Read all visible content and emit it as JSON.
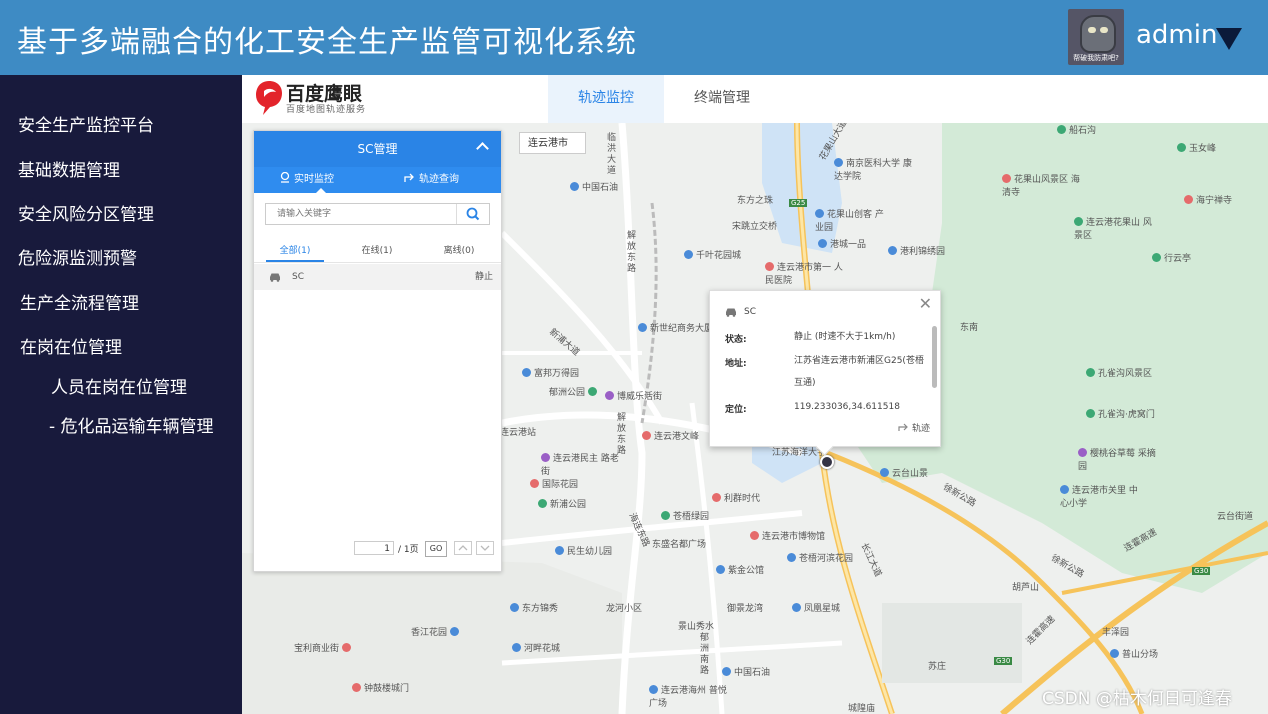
{
  "header": {
    "title": "基于多端融合的化工安全生产监管可视化系统",
    "avatar_caption": "帮破我防肃吧?",
    "username": "admin"
  },
  "sidebar": {
    "items": [
      {
        "label": "安全生产监控平台"
      },
      {
        "label": "基础数据管理"
      },
      {
        "label": "安全风险分区管理"
      },
      {
        "label": "危险源监测预警"
      },
      {
        "label": "生产全流程管理"
      },
      {
        "label": "在岗在位管理"
      },
      {
        "label": "人员在岗在位管理"
      },
      {
        "label": "- 危化品运输车辆管理"
      }
    ]
  },
  "topbar": {
    "logo_title": "百度鹰眼",
    "logo_subtitle": "百度地图轨迹服务",
    "tabs": [
      {
        "label": "轨迹监控"
      },
      {
        "label": "终端管理"
      }
    ]
  },
  "map": {
    "city_selector": "连云港市",
    "pois": [
      {
        "label": "船石沟"
      },
      {
        "label": "玉女峰"
      },
      {
        "label": "花果山风景区 海清寺"
      },
      {
        "label": "海宁禅寺"
      },
      {
        "label": "连云港花果山 风景区"
      },
      {
        "label": "行云亭"
      },
      {
        "label": "南京医科大学 康达学院"
      },
      {
        "label": "花果山创客 产业园"
      },
      {
        "label": "东方之珠"
      },
      {
        "label": "宋跳立交桥"
      },
      {
        "label": "港城一品"
      },
      {
        "label": "港利锦绣园"
      },
      {
        "label": "中国石油"
      },
      {
        "label": "千叶花园城"
      },
      {
        "label": "连云港市第一 人民医院"
      },
      {
        "label": "新世纪商务大厦"
      },
      {
        "label": "富邦万得园"
      },
      {
        "label": "郁洲公园"
      },
      {
        "label": "博威乐活街"
      },
      {
        "label": "连云港文峰"
      },
      {
        "label": "连云港站"
      },
      {
        "label": "连云港民主 路老街"
      },
      {
        "label": "国际花园"
      },
      {
        "label": "新浦公园"
      },
      {
        "label": "利群时代"
      },
      {
        "label": "苍梧绿园"
      },
      {
        "label": "连云港市博物馆"
      },
      {
        "label": "东盛名都广场"
      },
      {
        "label": "苍梧河滨花园"
      },
      {
        "label": "民生幼儿园"
      },
      {
        "label": "紫金公馆"
      },
      {
        "label": "御景龙湾"
      },
      {
        "label": "东方锦秀"
      },
      {
        "label": "龙河小区"
      },
      {
        "label": "凤凰星城"
      },
      {
        "label": "景山秀水"
      },
      {
        "label": "香江花园"
      },
      {
        "label": "河畔花城"
      },
      {
        "label": "宝利商业街"
      },
      {
        "label": "中国石油"
      },
      {
        "label": "钟鼓楼城门"
      },
      {
        "label": "连云港海州 普悦广场"
      },
      {
        "label": "孔雀沟风景区"
      },
      {
        "label": "孔雀沟·虎窝门"
      },
      {
        "label": "樱桃谷草莓 采摘园"
      },
      {
        "label": "云台山景"
      },
      {
        "label": "连云港市关里 中心小学"
      },
      {
        "label": "云台街道"
      },
      {
        "label": "丰泽园"
      },
      {
        "label": "普山分场"
      },
      {
        "label": "胡芦山"
      },
      {
        "label": "苏庄"
      },
      {
        "label": "城隍庙"
      },
      {
        "label": "江苏海洋大学"
      },
      {
        "label": "东南"
      }
    ],
    "roads": [
      {
        "label": "临洪大道"
      },
      {
        "label": "解放东路"
      },
      {
        "label": "新浦大道"
      },
      {
        "label": "解放东路"
      },
      {
        "label": "海连东路"
      },
      {
        "label": "长江大道"
      },
      {
        "label": "徐新公路"
      },
      {
        "label": "连霍高速"
      },
      {
        "label": "郁洲南路"
      },
      {
        "label": "徐新公路"
      },
      {
        "label": "连霍高速"
      },
      {
        "label": "花果山大道"
      }
    ],
    "highway_badges": [
      {
        "label": "G25"
      },
      {
        "label": "G30"
      },
      {
        "label": "G30"
      }
    ]
  },
  "panel": {
    "title": "SC管理",
    "tabs": [
      {
        "label": "实时监控"
      },
      {
        "label": "轨迹查询"
      }
    ],
    "search_placeholder": "请输入关键字",
    "filters": [
      {
        "label": "全部(1)"
      },
      {
        "label": "在线(1)"
      },
      {
        "label": "离线(0)"
      }
    ],
    "rows": [
      {
        "name": "SC",
        "status": "静止"
      }
    ],
    "pagination": {
      "current": "1",
      "label": "/ 1页",
      "go": "GO"
    }
  },
  "popup": {
    "vehicle": "SC",
    "status_label": "状态:",
    "status_value": "静止 (时速不大于1km/h)",
    "address_label": "地址:",
    "address_value": "江苏省连云港市新浦区G25(苍梧互通)",
    "location_label": "定位:",
    "location_value": "119.233036,34.611518",
    "track_label": "轨迹"
  },
  "watermark": "CSDN @枯木何日可逢春",
  "colors": {
    "header": "#3e8bc4",
    "sidebar": "#181a3c",
    "accent": "#2a84e6",
    "map_green": "#d7ecdb"
  }
}
